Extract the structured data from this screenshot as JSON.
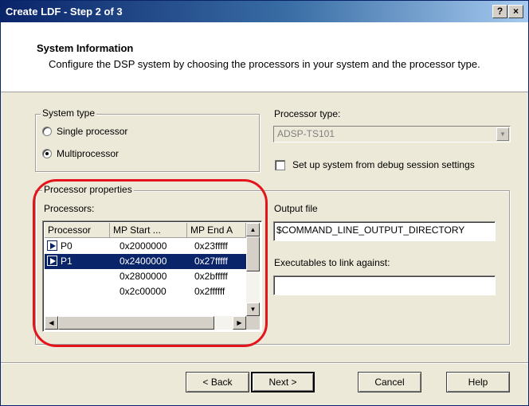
{
  "window": {
    "title": "Create LDF - Step 2 of 3",
    "help_button": "?",
    "close_button": "×"
  },
  "header": {
    "title": "System Information",
    "description": "Configure the DSP system by choosing the processors in your system and the processor type."
  },
  "system_type": {
    "label": "System type",
    "single_processor": "Single processor",
    "multiprocessor": "Multiprocessor",
    "selected": "Multiprocessor"
  },
  "processor_type": {
    "label": "Processor type:",
    "value": "ADSP-TS101",
    "enabled": false
  },
  "debug_session": {
    "label": "Set up system from debug session settings",
    "checked": false
  },
  "processor_properties": {
    "label": "Processor properties",
    "processors_label": "Processors:",
    "columns": [
      "Processor",
      "MP Start ...",
      "MP End A"
    ],
    "rows": [
      {
        "processor": "P0",
        "mp_start": "0x2000000",
        "mp_end": "0x23fffff",
        "selected": false
      },
      {
        "processor": "P1",
        "mp_start": "0x2400000",
        "mp_end": "0x27fffff",
        "selected": true
      },
      {
        "processor": "",
        "mp_start": "0x2800000",
        "mp_end": "0x2bfffff",
        "selected": false
      },
      {
        "processor": "",
        "mp_start": "0x2c00000",
        "mp_end": "0x2ffffff",
        "selected": false
      }
    ]
  },
  "output_file": {
    "label": "Output file",
    "value": "$COMMAND_LINE_OUTPUT_DIRECTORY"
  },
  "executables": {
    "label": "Executables to link against:",
    "value": ""
  },
  "buttons": {
    "back": "< Back",
    "next": "Next >",
    "cancel": "Cancel",
    "help": "Help"
  },
  "colors": {
    "title_bar": "#0a246a",
    "highlight_ring": "#e4141c",
    "selection": "#0a246a"
  }
}
